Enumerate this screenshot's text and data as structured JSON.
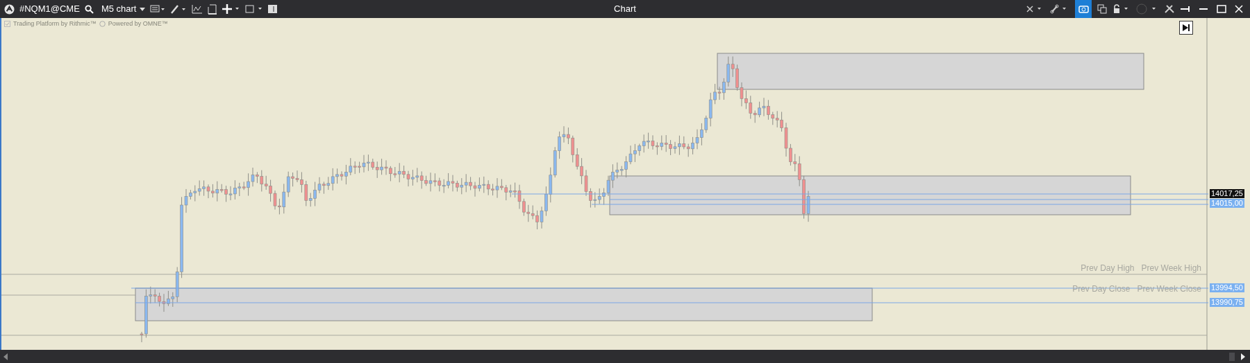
{
  "toolbar": {
    "symbol": "#NQM1@CME",
    "timeframe": "M5 chart",
    "title": "Chart",
    "screenshot_selected": true
  },
  "branding": [
    "Trading Platform by Rithmic™",
    "Powered by OMNE™"
  ],
  "level_rows": [
    {
      "labels": [
        "Prev Day High",
        "Prev Week High"
      ]
    },
    {
      "labels": [
        "Prev Day Close",
        "Prev Week Close"
      ]
    }
  ],
  "price_labels": [
    {
      "text": "14017,25",
      "kind": "last"
    },
    {
      "text": "14015,00",
      "kind": "level"
    },
    {
      "text": "13994,50",
      "kind": "level"
    },
    {
      "text": "13990,75",
      "kind": "level"
    }
  ]
}
